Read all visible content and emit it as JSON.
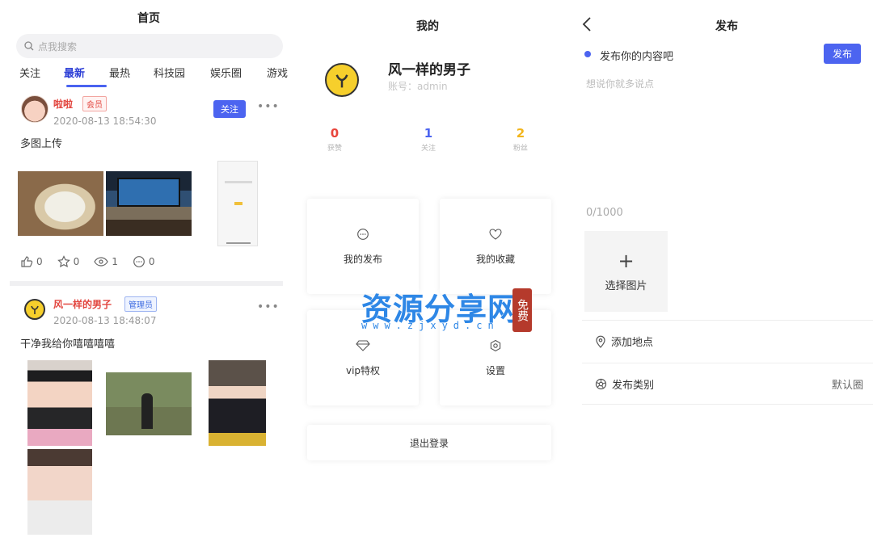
{
  "home": {
    "title": "首页",
    "search_placeholder": "点我搜索",
    "tabs": [
      "关注",
      "最新",
      "最热",
      "科技园",
      "娱乐圈",
      "游戏"
    ],
    "active_tab": "最新",
    "posts": [
      {
        "username": "啦啦",
        "badge": "会员",
        "time": "2020-08-13 18:54:30",
        "follow_label": "关注",
        "content": "多图上传",
        "likes": "0",
        "favorites": "0",
        "views": "1",
        "comments": "0"
      },
      {
        "username": "风一样的男子",
        "badge": "管理员",
        "time": "2020-08-13 18:48:07",
        "content": "干净我给你嘻嘻嘻嘻"
      }
    ]
  },
  "profile": {
    "title": "我的",
    "name": "风一样的男子",
    "account": "账号：admin",
    "stats": [
      {
        "value": "0",
        "label": "获赞",
        "color": "#e8453c"
      },
      {
        "value": "1",
        "label": "关注",
        "color": "#4c64f0"
      },
      {
        "value": "2",
        "label": "粉丝",
        "color": "#f2b51c"
      }
    ],
    "menu": [
      "我的发布",
      "我的收藏",
      "vip特权",
      "设置"
    ],
    "logout": "退出登录"
  },
  "publish": {
    "title": "发布",
    "label": "发布你的内容吧",
    "button": "发布",
    "placeholder": "想说你就多说点",
    "counter": "0/1000",
    "pick_image": "选择图片",
    "add_location": "添加地点",
    "category_label": "发布类别",
    "category_value": "默认圈"
  },
  "watermark": {
    "text": "资源分享网",
    "url": "www.zjxyd.cn",
    "seal": "免费"
  },
  "colors": {
    "accent": "#4c64f0",
    "red": "#e2463f"
  }
}
